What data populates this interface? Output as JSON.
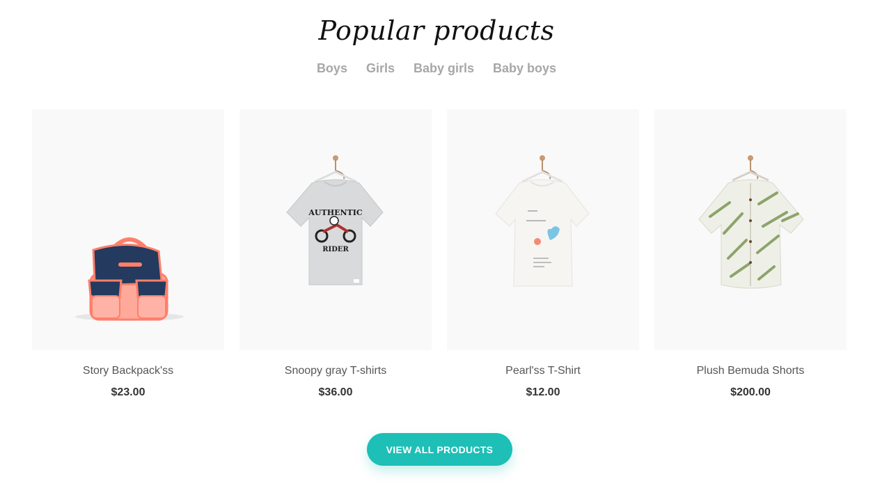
{
  "section": {
    "title": "Popular products",
    "tabs": [
      "Boys",
      "Girls",
      "Baby girls",
      "Baby boys"
    ]
  },
  "products": [
    {
      "name": "Story Backpack'ss",
      "price": "$23.00",
      "image": "pink-navy-backpack"
    },
    {
      "name": "Snoopy gray T-shirts",
      "price": "$36.00",
      "image": "gray-tshirt-hanger",
      "print_text": [
        "AUTHENTIC",
        "RIDER"
      ]
    },
    {
      "name": "Pearl'ss T-Shirt",
      "price": "$12.00",
      "image": "white-tshirt-hanger"
    },
    {
      "name": "Plush Bemuda Shorts",
      "price": "$200.00",
      "image": "palm-print-shirt-hanger"
    }
  ],
  "cta": {
    "label": "VIEW ALL PRODUCTS"
  },
  "colors": {
    "accent": "#1dbfb6",
    "tab_text": "#a7a7a7",
    "image_bg": "#f9f9f9"
  }
}
